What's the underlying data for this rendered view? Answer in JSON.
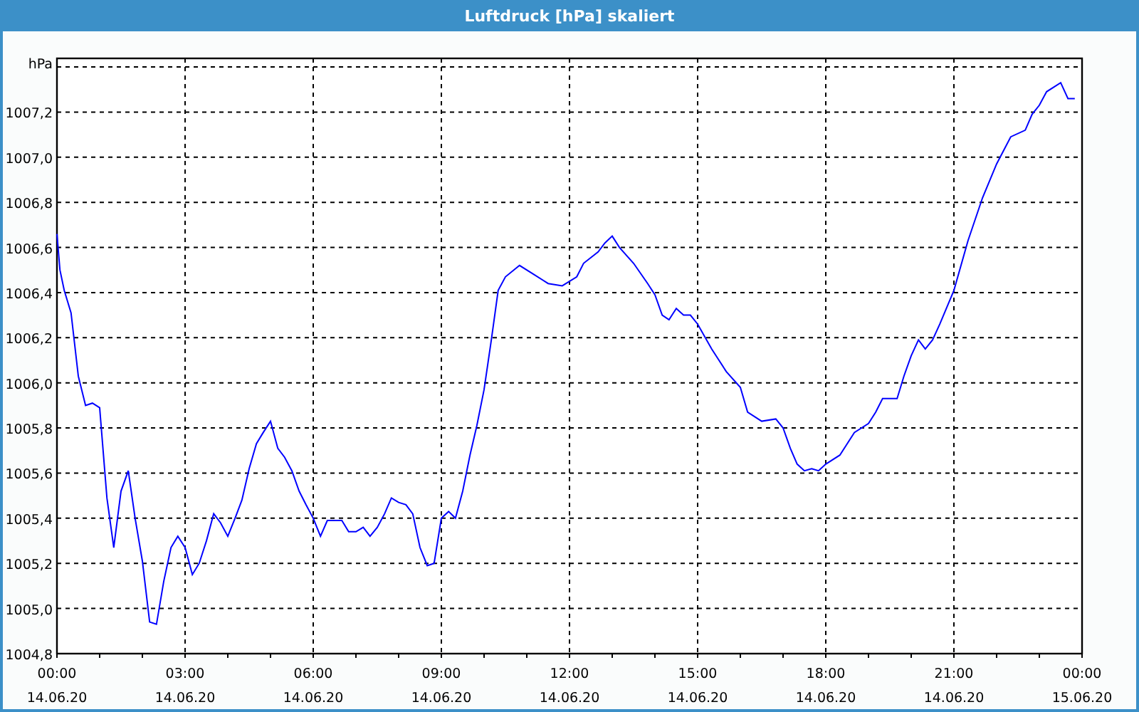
{
  "window": {
    "title": "Luftdruck [hPa] skaliert"
  },
  "chart": {
    "chart_data": {
      "type": "line",
      "ylabel": "hPa",
      "grid": true,
      "x": [
        0,
        0.07,
        0.17,
        0.33,
        0.5,
        0.67,
        0.83,
        1.0,
        1.17,
        1.33,
        1.5,
        1.67,
        1.83,
        2.0,
        2.17,
        2.33,
        2.5,
        2.67,
        2.83,
        3.0,
        3.17,
        3.33,
        3.5,
        3.67,
        3.83,
        4.0,
        4.17,
        4.33,
        4.5,
        4.67,
        4.83,
        5.0,
        5.17,
        5.33,
        5.5,
        5.67,
        5.83,
        6.0,
        6.17,
        6.33,
        6.5,
        6.67,
        6.83,
        7.0,
        7.17,
        7.33,
        7.5,
        7.67,
        7.83,
        8.0,
        8.17,
        8.33,
        8.5,
        8.67,
        8.83,
        9.0,
        9.17,
        9.33,
        9.5,
        9.67,
        9.83,
        10.0,
        10.17,
        10.33,
        10.5,
        10.83,
        11.17,
        11.5,
        11.83,
        12.17,
        12.33,
        12.67,
        12.83,
        13.0,
        13.17,
        13.5,
        13.83,
        14.0,
        14.17,
        14.33,
        14.5,
        14.67,
        14.83,
        15.0,
        15.33,
        15.67,
        16.0,
        16.17,
        16.5,
        16.83,
        17.0,
        17.17,
        17.33,
        17.5,
        17.67,
        17.83,
        18.0,
        18.33,
        18.67,
        19.0,
        19.17,
        19.33,
        19.67,
        19.83,
        20.0,
        20.17,
        20.33,
        20.5,
        20.67,
        21.0,
        21.33,
        21.67,
        22.0,
        22.33,
        22.67,
        22.83,
        23.0,
        23.17,
        23.5,
        23.67,
        23.83
      ],
      "series": [
        {
          "color": "#0000ff",
          "values": [
            1006.66,
            1006.5,
            1006.41,
            1006.31,
            1006.03,
            1005.9,
            1005.91,
            1005.89,
            1005.49,
            1005.27,
            1005.52,
            1005.61,
            1005.4,
            1005.21,
            1004.94,
            1004.93,
            1005.12,
            1005.27,
            1005.32,
            1005.27,
            1005.15,
            1005.2,
            1005.3,
            1005.42,
            1005.38,
            1005.32,
            1005.4,
            1005.48,
            1005.62,
            1005.73,
            1005.78,
            1005.83,
            1005.71,
            1005.67,
            1005.61,
            1005.52,
            1005.46,
            1005.4,
            1005.32,
            1005.39,
            1005.39,
            1005.39,
            1005.34,
            1005.34,
            1005.36,
            1005.32,
            1005.36,
            1005.42,
            1005.49,
            1005.47,
            1005.46,
            1005.42,
            1005.27,
            1005.19,
            1005.2,
            1005.4,
            1005.43,
            1005.4,
            1005.52,
            1005.68,
            1005.81,
            1005.97,
            1006.19,
            1006.41,
            1006.47,
            1006.52,
            1006.48,
            1006.44,
            1006.43,
            1006.47,
            1006.53,
            1006.58,
            1006.62,
            1006.65,
            1006.6,
            1006.53,
            1006.44,
            1006.39,
            1006.3,
            1006.28,
            1006.33,
            1006.3,
            1006.3,
            1006.26,
            1006.15,
            1006.05,
            1005.98,
            1005.87,
            1005.83,
            1005.84,
            1005.8,
            1005.71,
            1005.64,
            1005.61,
            1005.62,
            1005.61,
            1005.64,
            1005.68,
            1005.78,
            1005.82,
            1005.87,
            1005.93,
            1005.93,
            1006.03,
            1006.12,
            1006.19,
            1006.15,
            1006.19,
            1006.26,
            1006.41,
            1006.63,
            1006.82,
            1006.97,
            1007.09,
            1007.12,
            1007.19,
            1007.23,
            1007.29,
            1007.33,
            1007.26,
            1007.26
          ]
        }
      ],
      "xlim": [
        0,
        24
      ],
      "ylim": [
        1004.8,
        1007.4
      ],
      "xticks": [
        {
          "value": 0,
          "label": "00:00"
        },
        {
          "value": 3,
          "label": "03:00"
        },
        {
          "value": 6,
          "label": "06:00"
        },
        {
          "value": 9,
          "label": "09:00"
        },
        {
          "value": 12,
          "label": "12:00"
        },
        {
          "value": 15,
          "label": "15:00"
        },
        {
          "value": 18,
          "label": "18:00"
        },
        {
          "value": 21,
          "label": "21:00"
        },
        {
          "value": 24,
          "label": "00:00"
        }
      ],
      "yticks": [
        {
          "value": 1004.8,
          "label": "1004,8"
        },
        {
          "value": 1005.0,
          "label": "1005,0"
        },
        {
          "value": 1005.2,
          "label": "1005,2"
        },
        {
          "value": 1005.4,
          "label": "1005,4"
        },
        {
          "value": 1005.6,
          "label": "1005,6"
        },
        {
          "value": 1005.8,
          "label": "1005,8"
        },
        {
          "value": 1006.0,
          "label": "1006,0"
        },
        {
          "value": 1006.2,
          "label": "1006,2"
        },
        {
          "value": 1006.4,
          "label": "1006,4"
        },
        {
          "value": 1006.6,
          "label": "1006,6"
        },
        {
          "value": 1006.8,
          "label": "1006,8"
        },
        {
          "value": 1007.0,
          "label": "1007,0"
        },
        {
          "value": 1007.2,
          "label": "1007,2"
        }
      ]
    },
    "x_axis_dates": [
      "14.06.20",
      "14.06.20",
      "14.06.20",
      "14.06.20",
      "14.06.20",
      "14.06.20",
      "14.06.20",
      "14.06.20",
      "15.06.20"
    ]
  }
}
